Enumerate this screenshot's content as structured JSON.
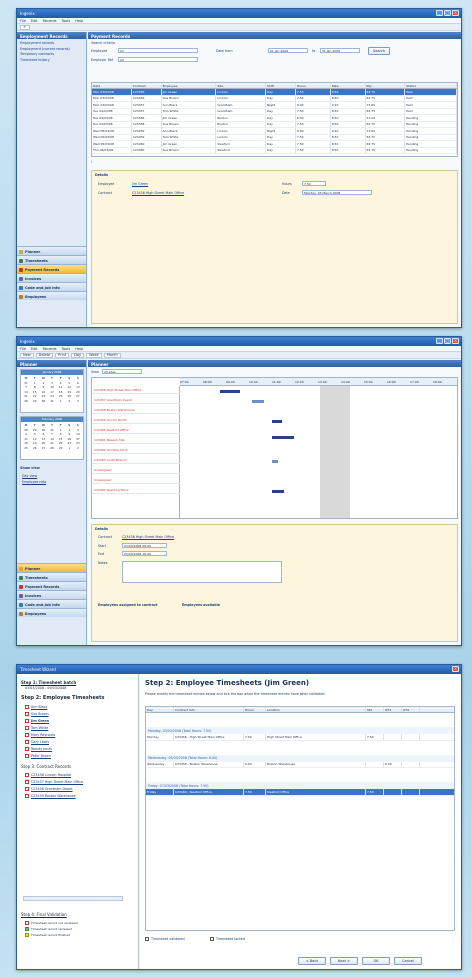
{
  "win1": {
    "title": "Ingenix",
    "menus": [
      "File",
      "Edit",
      "Records",
      "Tools",
      "Help"
    ],
    "left_header": "Employment Records",
    "left_links": [
      "Employment records",
      "Employment (current records)",
      "Temporary contracts",
      "Timesheet history"
    ],
    "nav": [
      {
        "label": "Planner",
        "active": false,
        "color": "#d9a441"
      },
      {
        "label": "Timesheets",
        "active": false,
        "color": "#3f7d4f"
      },
      {
        "label": "Payment Records",
        "active": true,
        "color": "#c0392b"
      },
      {
        "label": "Invoices",
        "active": false,
        "color": "#6b5aa6"
      },
      {
        "label": "Code and Job Info",
        "active": false,
        "color": "#2d7cc4"
      },
      {
        "label": "Employees",
        "active": false,
        "color": "#c47a2d"
      }
    ],
    "content_header": "Payment Records",
    "search_label": "Search criteria",
    "filter_labels": {
      "employee": "Employee",
      "job": "Employer Ref",
      "from": "Date from",
      "to": "to",
      "search_btn": "Search"
    },
    "filter_values": {
      "employee": "All",
      "job": "All",
      "from": "01 Jan 2008",
      "to": "31 Jan 2008"
    },
    "grid_cols": [
      "Date",
      "Contract",
      "Employee",
      "Site",
      "Shift",
      "Hours",
      "Rate",
      "Pay",
      "Status"
    ],
    "grid_rows": [
      [
        "Mon 03/03/08",
        "C23456",
        "Jim Green",
        "Lincoln",
        "Day",
        "7.50",
        "8.50",
        "63.75",
        "Paid"
      ],
      [
        "Mon 03/03/08",
        "C23456",
        "Sue Brown",
        "Lincoln",
        "Day",
        "7.50",
        "8.50",
        "63.75",
        "Paid"
      ],
      [
        "Mon 03/03/08",
        "C23457",
        "Ann Black",
        "Grantham",
        "Night",
        "8.00",
        "9.20",
        "73.60",
        "Paid"
      ],
      [
        "Tue 04/03/08",
        "C23457",
        "Tom White",
        "Grantham",
        "Day",
        "7.50",
        "8.50",
        "63.75",
        "Paid"
      ],
      [
        "Tue 04/03/08",
        "C23458",
        "Jim Green",
        "Boston",
        "Day",
        "6.00",
        "8.50",
        "51.00",
        "Pending"
      ],
      [
        "Tue 04/03/08",
        "C23458",
        "Sue Brown",
        "Boston",
        "Day",
        "7.50",
        "8.50",
        "63.75",
        "Pending"
      ],
      [
        "Wed 05/03/08",
        "C23459",
        "Ann Black",
        "Lincoln",
        "Night",
        "8.00",
        "9.20",
        "73.60",
        "Pending"
      ],
      [
        "Wed 05/03/08",
        "C23459",
        "Tom White",
        "Lincoln",
        "Day",
        "7.50",
        "8.50",
        "63.75",
        "Pending"
      ],
      [
        "Wed 05/03/08",
        "C23460",
        "Jim Green",
        "Sleaford",
        "Day",
        "7.50",
        "8.50",
        "63.75",
        "Pending"
      ],
      [
        "Thu 06/03/08",
        "C23460",
        "Sue Brown",
        "Sleaford",
        "Day",
        "7.50",
        "8.50",
        "63.75",
        "Pending"
      ]
    ],
    "detail_title": "Details",
    "detail_labels": {
      "employee": "Employee",
      "contract": "Contract",
      "hours": "Hours",
      "date": "Date"
    },
    "detail_values": {
      "employee": "Jim Green",
      "contract": "C23456 High Street Main Office",
      "hours": "7.50",
      "date": "Monday, 03 March 2008"
    }
  },
  "win2": {
    "title": "Ingenix",
    "menus": [
      "File",
      "Edit",
      "Records",
      "Tools",
      "Help"
    ],
    "tools": [
      "New",
      "Delete",
      "Print",
      "Day",
      "Week",
      "Month"
    ],
    "left_header": "Planner",
    "cal1_title": "January 2008",
    "cal2_title": "February 2008",
    "days": [
      "M",
      "T",
      "W",
      "T",
      "F",
      "S",
      "S"
    ],
    "cal1_dates": [
      "31",
      "1",
      "2",
      "3",
      "4",
      "5",
      "6",
      "7",
      "8",
      "9",
      "10",
      "11",
      "12",
      "13",
      "14",
      "15",
      "16",
      "17",
      "18",
      "19",
      "20",
      "21",
      "22",
      "23",
      "24",
      "25",
      "26",
      "27",
      "28",
      "29",
      "30",
      "31",
      "1",
      "2",
      "3"
    ],
    "cal2_dates": [
      "28",
      "29",
      "30",
      "31",
      "1",
      "2",
      "3",
      "4",
      "5",
      "6",
      "7",
      "8",
      "9",
      "10",
      "11",
      "12",
      "13",
      "14",
      "15",
      "16",
      "17",
      "18",
      "19",
      "20",
      "21",
      "22",
      "23",
      "24",
      "25",
      "26",
      "27",
      "28",
      "29",
      "1",
      "2"
    ],
    "left_links_header": "Show view",
    "left_links": [
      "Day view",
      "Employee rota"
    ],
    "nav": [
      {
        "label": "Planner",
        "active": true,
        "color": "#d9a441"
      },
      {
        "label": "Timesheets",
        "active": false,
        "color": "#3f7d4f"
      },
      {
        "label": "Payment Records",
        "active": false,
        "color": "#c0392b"
      },
      {
        "label": "Invoices",
        "active": false,
        "color": "#6b5aa6"
      },
      {
        "label": "Code and Job Info",
        "active": false,
        "color": "#2d7cc4"
      },
      {
        "label": "Employees",
        "active": false,
        "color": "#c47a2d"
      }
    ],
    "content_header": "Planner",
    "view_label": "View",
    "view_value": "All sites",
    "times": [
      "07:00",
      "08:00",
      "09:00",
      "10:00",
      "11:00",
      "12:00",
      "13:00",
      "14:00",
      "15:00",
      "16:00",
      "17:00",
      "18:00"
    ],
    "rows": [
      "C23456 High Street Main Office",
      "C23457 Grantham Depot",
      "C23458 Boston Warehouse",
      "C23459 Lincoln North",
      "C23460 Sleaford Office",
      "C23461 Newark Site",
      "C23462 Grimsby Dock",
      "C23463 Louth Branch",
      "Unassigned",
      "Unassigned",
      "C23464 Spalding Store"
    ],
    "detail_title": "Details",
    "detail_labels": {
      "contract": "Contract",
      "start": "Start",
      "end": "End",
      "notes": "Notes",
      "staff": "Employees assigned to contract",
      "avail": "Employees available"
    },
    "detail_values": {
      "contract": "C23456 High Street Main Office",
      "start": "03/03/2008 08:00",
      "end": "03/03/2008 16:00"
    }
  },
  "win3": {
    "title": "Timesheet Wizard",
    "step1": "Step 1: Timesheet batch",
    "step1_sub": "03/03/2008 - 09/03/2008",
    "step2": "Step 2: Employee Timesheets",
    "employees": [
      "Ann Black",
      "Sue Brown",
      "Jim Green",
      "Tom White",
      "Mary Reynolds",
      "Gary Lewis",
      "Wendy Jones",
      "Peter Brown"
    ],
    "step3": "Step 3: Contract Records",
    "contracts": [
      "C23456 Lincoln Hospital",
      "C23457 High Street Main Office",
      "C23458 Grantham Depot",
      "C23459 Boston Warehouse"
    ],
    "step4": "Step 4: Final Validation",
    "legend": [
      "Timesheet record not reviewed",
      "Timesheet record reviewed",
      "Timesheet record finished"
    ],
    "heading": "Step 2: Employee Timesheets (Jim Green)",
    "intro": "Please modify the timesheet entries below and tick the box when the timesheet entries have been validated.",
    "cols": [
      "Day",
      "Contract Info",
      "Hours",
      "Location",
      "Std",
      "OT1",
      "OT2"
    ],
    "day_groups": [
      {
        "label": "Monday, 03/03/2008 (Total Hours: 7.50)",
        "rows": [
          [
            "Monday",
            "C23456 - High Street Main Office",
            "7.50",
            "High Street Main Office",
            "7.50",
            "",
            ""
          ]
        ]
      },
      {
        "label": "Wednesday, 05/03/2008 (Total Hours: 6.00)",
        "rows": [
          [
            "Wednesday",
            "C23458 - Boston Warehouse",
            "6.00",
            "Boston Warehouse",
            "",
            "6.00",
            ""
          ]
        ]
      },
      {
        "label": "Friday, 07/03/2008 (Total Hours: 7.50)",
        "rows": [
          [
            "Friday",
            "C23460 - Sleaford Office",
            "7.50",
            "Sleaford Office",
            "7.50",
            "",
            ""
          ]
        ]
      }
    ],
    "check1": "Timesheet validated",
    "check2": "Timesheet locked",
    "buttons": [
      "< Back",
      "Next >",
      "OK",
      "Cancel"
    ]
  }
}
